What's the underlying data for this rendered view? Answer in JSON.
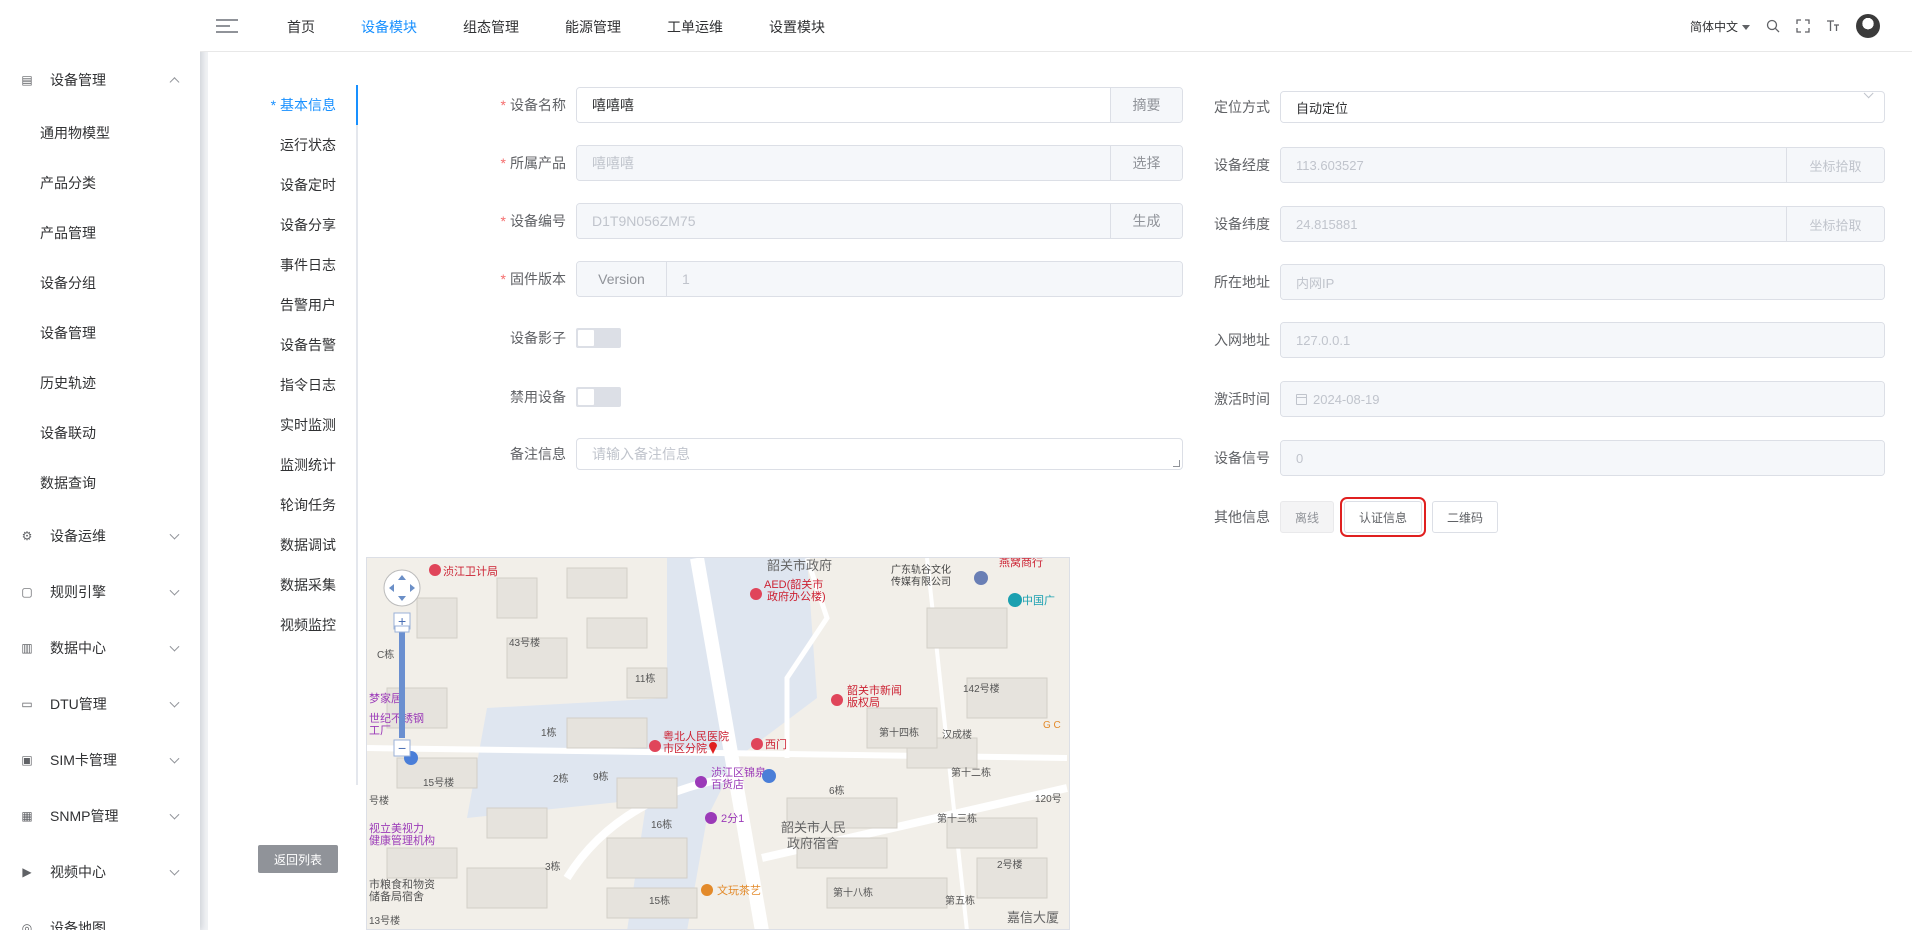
{
  "sidebar": {
    "groups": [
      {
        "label": "设备管理",
        "icon": "device-icon",
        "expanded": true,
        "items": [
          "通用物模型",
          "产品分类",
          "产品管理",
          "设备分组",
          "设备管理",
          "历史轨迹",
          "设备联动",
          "数据查询"
        ]
      },
      {
        "label": "设备运维",
        "icon": "maintenance-icon"
      },
      {
        "label": "规则引擎",
        "icon": "rule-icon"
      },
      {
        "label": "数据中心",
        "icon": "data-center-icon"
      },
      {
        "label": "DTU管理",
        "icon": "dtu-icon"
      },
      {
        "label": "SIM卡管理",
        "icon": "sim-icon"
      },
      {
        "label": "SNMP管理",
        "icon": "snmp-icon"
      },
      {
        "label": "视频中心",
        "icon": "video-icon"
      },
      {
        "label": "设备地图",
        "icon": "map-icon"
      }
    ]
  },
  "topnav": {
    "items": [
      "首页",
      "设备模块",
      "组态管理",
      "能源管理",
      "工单运维",
      "设置模块"
    ],
    "active_index": 1,
    "language": "简体中文"
  },
  "tabs": {
    "items": [
      "基本信息",
      "运行状态",
      "设备定时",
      "设备分享",
      "事件日志",
      "告警用户",
      "设备告警",
      "指令日志",
      "实时监测",
      "监测统计",
      "轮询任务",
      "数据调试",
      "数据采集",
      "视频监控"
    ],
    "active_index": 0,
    "back_label": "返回列表"
  },
  "form_left": {
    "device_name": {
      "label": "设备名称",
      "value": "嘻嘻嘻",
      "append": "摘要"
    },
    "product": {
      "label": "所属产品",
      "value": "嘻嘻嘻",
      "append": "选择"
    },
    "device_code": {
      "label": "设备编号",
      "value": "D1T9N056ZM75",
      "append": "生成"
    },
    "firmware": {
      "label": "固件版本",
      "prepend": "Version",
      "value": "1"
    },
    "shadow": {
      "label": "设备影子",
      "on": false
    },
    "disabled": {
      "label": "禁用设备",
      "on": false
    },
    "remark": {
      "label": "备注信息",
      "placeholder": "请输入备注信息"
    }
  },
  "form_right": {
    "location_mode": {
      "label": "定位方式",
      "value": "自动定位"
    },
    "longitude": {
      "label": "设备经度",
      "value": "113.603527",
      "append": "坐标拾取"
    },
    "latitude": {
      "label": "设备纬度",
      "value": "24.815881",
      "append": "坐标拾取"
    },
    "address": {
      "label": "所在地址",
      "value": "内网IP"
    },
    "net_address": {
      "label": "入网地址",
      "value": "127.0.0.1"
    },
    "activate_time": {
      "label": "激活时间",
      "value": "2024-08-19"
    },
    "signal": {
      "label": "设备信号",
      "value": "0"
    },
    "other": {
      "label": "其他信息",
      "status": "离线",
      "auth_btn": "认证信息",
      "qr_btn": "二维码"
    }
  },
  "map": {
    "labels": [
      "浈江卫计局",
      "韶关市政府",
      "AED(韶关市",
      "政府办公楼)",
      "广东轨谷文化",
      "传媒有限公司",
      "燕窝商行",
      "中国广",
      "43号楼",
      "C栋",
      "11栋",
      "韶关市新闻",
      "版权局",
      "142号楼",
      "梦家居",
      "世纪不锈钢",
      "工厂",
      "1栋",
      "粤北人民医院",
      "市区分院",
      "西门",
      "第十四栋",
      "汉成楼",
      "G C",
      "第十二栋",
      "15号楼",
      "2栋",
      "9栋",
      "浈江区锦泉",
      "百货店",
      "6栋",
      "120号",
      "号楼",
      "第十三栋",
      "16栋",
      "2分1",
      "韶关市人民",
      "政府宿舍",
      "视立美视力",
      "健康管理机构",
      "3栋",
      "2号楼",
      "市粮食和物资",
      "储备局宿舍",
      "15栋",
      "文玩茶艺",
      "第十八栋",
      "第五栋",
      "嘉信大厦",
      "13号楼"
    ]
  },
  "colors": {
    "accent": "#1890ff",
    "required": "#f56c6c",
    "highlight": "#e02020",
    "back_button": "#909399"
  }
}
